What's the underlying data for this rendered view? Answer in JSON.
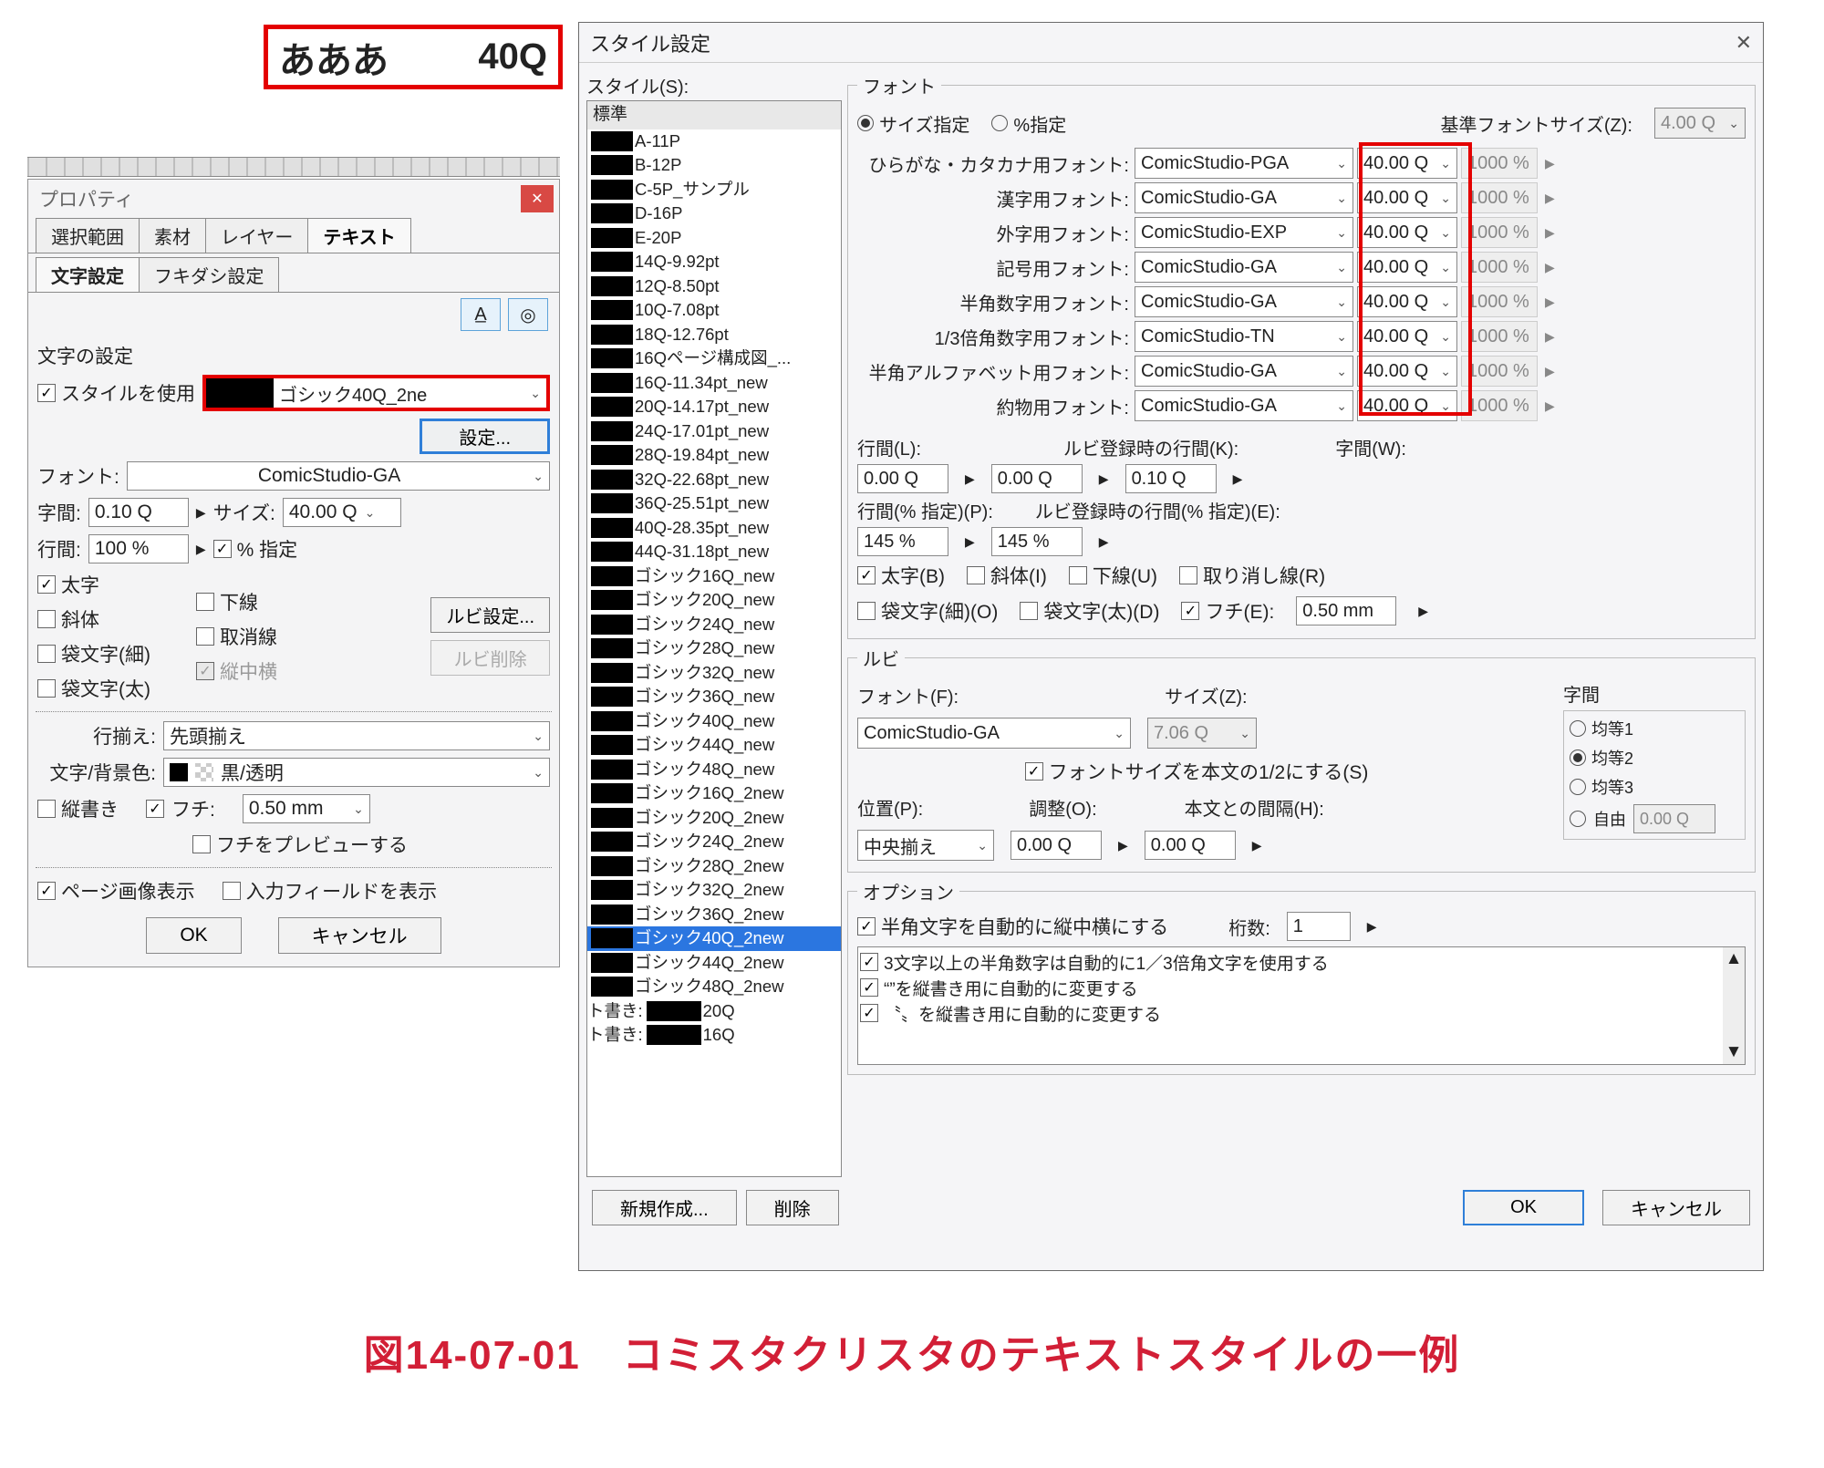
{
  "sample": {
    "text": "あああ",
    "q": "40Q"
  },
  "prop": {
    "title": "プロパティ",
    "tabs": [
      "選択範囲",
      "素材",
      "レイヤー",
      "テキスト"
    ],
    "subtabs": [
      "文字設定",
      "フキダシ設定"
    ],
    "section": "文字の設定",
    "useStyle": "スタイルを使用",
    "styleText": "ゴシック40Q_2ne",
    "settingsBtn": "設定...",
    "fontLabel": "フォント:",
    "fontValue": "ComicStudio-GA",
    "kerningLabel": "字間:",
    "kerningValue": "0.10 Q",
    "sizeLabel": "サイズ:",
    "sizeValue": "40.00 Q",
    "lineLabel": "行間:",
    "lineValue": "100 %",
    "pctSpec": "% 指定",
    "bold": "太字",
    "underline": "下線",
    "italic": "斜体",
    "strike": "取消線",
    "outlineThin": "袋文字(細)",
    "tateChuYoko": "縦中横",
    "outlineThick": "袋文字(太)",
    "rubySettings": "ルビ設定...",
    "rubyDelete": "ルビ削除",
    "alignLabel": "行揃え:",
    "alignValue": "先頭揃え",
    "colorLabel": "文字/背景色:",
    "colorValue": "黒/透明",
    "vertical": "縦書き",
    "edge": "フチ:",
    "edgeValue": "0.50 mm",
    "previewEdge": "フチをプレビューする",
    "showPageImage": "ページ画像表示",
    "showInputField": "入力フィールドを表示",
    "ok": "OK",
    "cancel": "キャンセル"
  },
  "dlg": {
    "title": "スタイル設定",
    "listLabel": "スタイル(S):",
    "listHeader": "標準",
    "styles": [
      "A-11P",
      "B-12P",
      "C-5P_サンプル",
      "D-16P",
      "E-20P",
      "14Q-9.92pt",
      "12Q-8.50pt",
      "10Q-7.08pt",
      "18Q-12.76pt",
      "16Qページ構成図_...",
      "16Q-11.34pt_new",
      "20Q-14.17pt_new",
      "24Q-17.01pt_new",
      "28Q-19.84pt_new",
      "32Q-22.68pt_new",
      "36Q-25.51pt_new",
      "40Q-28.35pt_new",
      "44Q-31.18pt_new",
      "ゴシック16Q_new",
      "ゴシック20Q_new",
      "ゴシック24Q_new",
      "ゴシック28Q_new",
      "ゴシック32Q_new",
      "ゴシック36Q_new",
      "ゴシック40Q_new",
      "ゴシック44Q_new",
      "ゴシック48Q_new",
      "ゴシック16Q_2new",
      "ゴシック20Q_2new",
      "ゴシック24Q_2new",
      "ゴシック28Q_2new",
      "ゴシック32Q_2new",
      "ゴシック36Q_2new",
      "ゴシック40Q_2new",
      "ゴシック44Q_2new",
      "ゴシック48Q_2new"
    ],
    "stylesBlock2": [
      "ト書き:",
      "ト書き:"
    ],
    "stylesBlock2Suffix": [
      "20Q",
      "16Q"
    ],
    "selectedStyle": "ゴシック40Q_2new",
    "fontGroup": "フォント",
    "sizeSpec": "サイズ指定",
    "pctSpec": "%指定",
    "baseSizeLabel": "基準フォントサイズ(Z):",
    "baseSizeValue": "4.00 Q",
    "fontRows": [
      {
        "label": "ひらがな・カタカナ用フォント:",
        "name": "ComicStudio-PGA",
        "q": "40.00 Q",
        "pct": "1000 %"
      },
      {
        "label": "漢字用フォント:",
        "name": "ComicStudio-GA",
        "q": "40.00 Q",
        "pct": "1000 %"
      },
      {
        "label": "外字用フォント:",
        "name": "ComicStudio-EXP",
        "q": "40.00 Q",
        "pct": "1000 %"
      },
      {
        "label": "記号用フォント:",
        "name": "ComicStudio-GA",
        "q": "40.00 Q",
        "pct": "1000 %"
      },
      {
        "label": "半角数字用フォント:",
        "name": "ComicStudio-GA",
        "q": "40.00 Q",
        "pct": "1000 %"
      },
      {
        "label": "1/3倍角数字用フォント:",
        "name": "ComicStudio-TN",
        "q": "40.00 Q",
        "pct": "1000 %"
      },
      {
        "label": "半角アルファベット用フォント:",
        "name": "ComicStudio-GA",
        "q": "40.00 Q",
        "pct": "1000 %"
      },
      {
        "label": "約物用フォント:",
        "name": "ComicStudio-GA",
        "q": "40.00 Q",
        "pct": "1000 %"
      }
    ],
    "lineL": "行間(L):",
    "lineLVal": "0.00 Q",
    "rubyK": "ルビ登録時の行間(K):",
    "rubyKVal": "0.00 Q",
    "kernW": "字間(W):",
    "kernWVal": "0.10 Q",
    "linePct": "行間(% 指定)(P):",
    "linePctVal": "145 %",
    "rubyPct": "ルビ登録時の行間(% 指定)(E):",
    "rubyPctVal": "145 %",
    "boldB": "太字(B)",
    "italicI": "斜体(I)",
    "underlineU": "下線(U)",
    "strikeR": "取り消し線(R)",
    "outlineThinO": "袋文字(細)(O)",
    "outlineThickD": "袋文字(太)(D)",
    "edgeE": "フチ(E):",
    "edgeVal": "0.50 mm",
    "rubyGroup": "ルビ",
    "rubyFontLabel": "フォント(F):",
    "rubyFontVal": "ComicStudio-GA",
    "rubySizeLabel": "サイズ(Z):",
    "rubySizeVal": "7.06 Q",
    "rubyHalf": "フォントサイズを本文の1/2にする(S)",
    "rubyPos": "位置(P):",
    "rubyPosVal": "中央揃え",
    "rubyAdj": "調整(O):",
    "rubyAdjVal": "0.00 Q",
    "rubyGap": "本文との間隔(H):",
    "rubyGapVal": "0.00 Q",
    "rubyKernTitle": "字間",
    "rubyKernOptions": [
      "均等1",
      "均等2",
      "均等3",
      "自由"
    ],
    "rubyKernFree": "0.00 Q",
    "optGroup": "オプション",
    "optTate": "半角文字を自動的に縦中横にする",
    "optDigitsLabel": "桁数:",
    "optDigitsVal": "1",
    "optList": [
      "3文字以上の半角数字は自動的に1／3倍角文字を使用する",
      "“”を縦書き用に自動的に変更する",
      "〝〟を縦書き用に自動的に変更する"
    ],
    "newBtn": "新規作成...",
    "deleteBtn": "削除",
    "ok": "OK",
    "cancel": "キャンセル"
  },
  "caption": "図14-07-01　コミスタクリスタのテキストスタイルの一例"
}
